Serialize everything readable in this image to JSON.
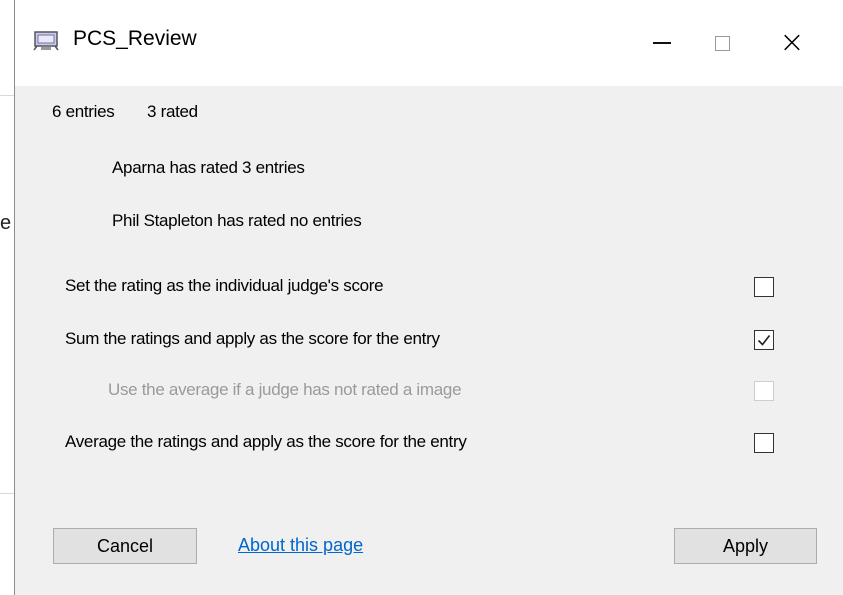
{
  "background": {
    "partial_text": "e"
  },
  "window": {
    "title": "PCS_Review",
    "icon": "app-window-icon",
    "controls": {
      "minimize": "minimize-icon",
      "maximize": "maximize-icon",
      "close": "close-icon",
      "close_glyph": "×"
    }
  },
  "summary": {
    "entries": "6 entries",
    "rated": "3 rated"
  },
  "judges": [
    {
      "text": "Aparna has rated 3 entries"
    },
    {
      "text": "Phil Stapleton has rated no entries"
    }
  ],
  "options": [
    {
      "label": "Set the rating as the individual judge's score",
      "checked": false,
      "enabled": true
    },
    {
      "label": "Sum the ratings and apply as the score for the entry",
      "checked": true,
      "enabled": true
    },
    {
      "label": "Use the average if a judge has not rated a image",
      "checked": false,
      "enabled": false
    },
    {
      "label": "Average the ratings and apply as the score for the entry",
      "checked": false,
      "enabled": true
    }
  ],
  "footer": {
    "cancel_label": "Cancel",
    "about_label": "About this page",
    "apply_label": "Apply"
  },
  "colors": {
    "link": "#0066cc",
    "dialog_bg": "#f0f0f0",
    "disabled_text": "#9a9a9a"
  }
}
